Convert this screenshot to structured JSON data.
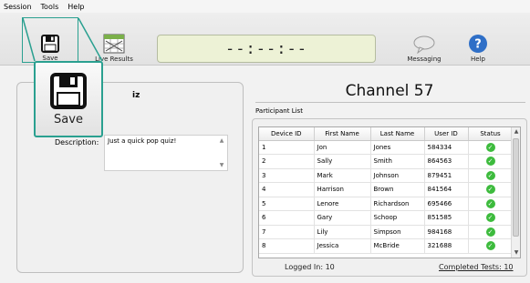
{
  "menu": [
    "Session",
    "Tools",
    "Help"
  ],
  "toolbar": {
    "save_label": "Save",
    "live_results_label": "Live Results",
    "messaging_label": "Messaging",
    "help_label": "Help",
    "timer": "--:--:--"
  },
  "quiz": {
    "title_fragment": "iz",
    "description_label": "Description:",
    "description_value": "Just a quick pop quiz!"
  },
  "channel": {
    "title": "Channel 57",
    "participant_list_label": "Participant List",
    "columns": [
      "Device ID",
      "First Name",
      "Last Name",
      "User ID",
      "Status"
    ],
    "rows": [
      [
        "1",
        "Jon",
        "Jones",
        "584334",
        "ok"
      ],
      [
        "2",
        "Sally",
        "Smith",
        "864563",
        "ok"
      ],
      [
        "3",
        "Mark",
        "Johnson",
        "879451",
        "ok"
      ],
      [
        "4",
        "Harrison",
        "Brown",
        "841564",
        "ok"
      ],
      [
        "5",
        "Lenore",
        "Richardson",
        "695466",
        "ok"
      ],
      [
        "6",
        "Gary",
        "Schoop",
        "851585",
        "ok"
      ],
      [
        "7",
        "Lily",
        "Simpson",
        "984168",
        "ok"
      ],
      [
        "8",
        "Jessica",
        "McBride",
        "321688",
        "ok"
      ]
    ],
    "logged_in": "Logged In: 10",
    "completed_tests": "Completed Tests: 10"
  },
  "zoom_callout": {
    "label": "Save"
  },
  "colors": {
    "callout_border": "#2aa090",
    "status_ok": "#3dbb3d",
    "help_icon": "#2f6fc7"
  }
}
